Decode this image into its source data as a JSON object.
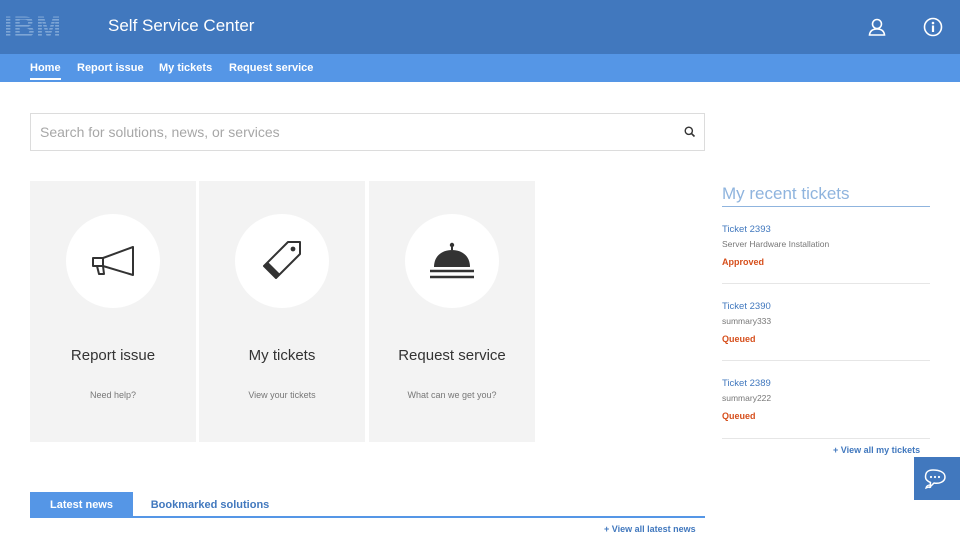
{
  "header": {
    "logo_text": "IBM",
    "app_title": "Self Service Center",
    "brand_color": "#4178be",
    "icons": [
      "user-icon",
      "info-icon"
    ]
  },
  "nav": {
    "items": [
      {
        "label": "Home",
        "active": true
      },
      {
        "label": "Report issue",
        "active": false
      },
      {
        "label": "My tickets",
        "active": false
      },
      {
        "label": "Request service",
        "active": false
      }
    ],
    "color": "#5596e6"
  },
  "search": {
    "placeholder": "Search for solutions, news, or services",
    "value": ""
  },
  "tiles": [
    {
      "title": "Report issue",
      "subtitle": "Need help?",
      "icon": "megaphone-icon"
    },
    {
      "title": "My tickets",
      "subtitle": "View your tickets",
      "icon": "tag-icon"
    },
    {
      "title": "Request service",
      "subtitle": "What can we get you?",
      "icon": "service-bell-icon"
    }
  ],
  "recent_tickets": {
    "title": "My recent tickets",
    "tickets": [
      {
        "id": "Ticket 2393",
        "summary": "Server Hardware Installation",
        "status": "Approved"
      },
      {
        "id": "Ticket 2390",
        "summary": "summary333",
        "status": "Queued"
      },
      {
        "id": "Ticket 2389",
        "summary": "summary222",
        "status": "Queued"
      }
    ],
    "view_all": "+ View all my tickets",
    "status_color": "#d64f1c"
  },
  "news": {
    "tabs": [
      {
        "label": "Latest news",
        "active": true
      },
      {
        "label": "Bookmarked solutions",
        "active": false
      }
    ],
    "view_all": "+ View all latest news"
  },
  "chat": {
    "icon": "chat-icon"
  }
}
